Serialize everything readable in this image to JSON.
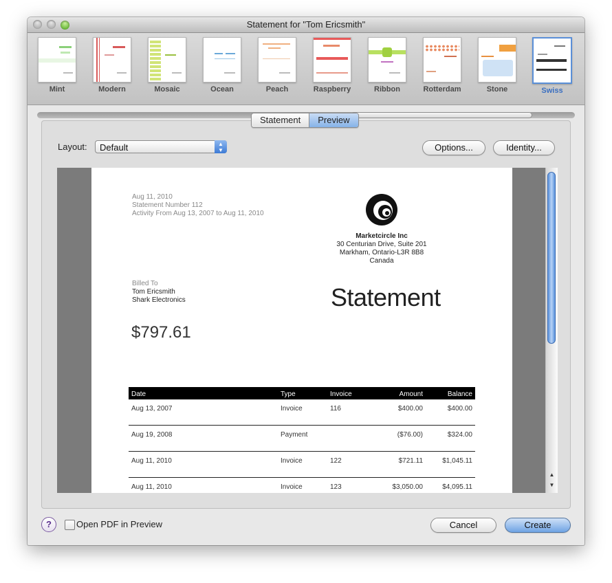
{
  "window": {
    "title": "Statement for \"Tom Ericsmith\""
  },
  "themes": [
    {
      "name": "Mint",
      "selected": false
    },
    {
      "name": "Modern",
      "selected": false
    },
    {
      "name": "Mosaic",
      "selected": false
    },
    {
      "name": "Ocean",
      "selected": false
    },
    {
      "name": "Peach",
      "selected": false
    },
    {
      "name": "Raspberry",
      "selected": false
    },
    {
      "name": "Ribbon",
      "selected": false
    },
    {
      "name": "Rotterdam",
      "selected": false
    },
    {
      "name": "Stone",
      "selected": false
    },
    {
      "name": "Swiss",
      "selected": true
    }
  ],
  "tabs": {
    "statement": "Statement",
    "preview": "Preview",
    "active": "Preview"
  },
  "layout": {
    "label": "Layout:",
    "value": "Default"
  },
  "buttons": {
    "options": "Options...",
    "identity": "Identity...",
    "cancel": "Cancel",
    "create": "Create"
  },
  "open_pdf": {
    "label": "Open PDF in Preview",
    "checked": false
  },
  "help_label": "?",
  "document": {
    "date": "Aug 11, 2010",
    "statement_number": "Statement Number 112",
    "activity": "Activity From Aug 13, 2007 to Aug 11, 2010",
    "company": {
      "name": "Marketcircle Inc",
      "address1": "30 Centurian Drive, Suite 201",
      "address2": "Markham, Ontario-L3R 8B8",
      "country": "Canada"
    },
    "billed_to_label": "Billed To",
    "billed_name": "Tom Ericsmith",
    "billed_company": "Shark Electronics",
    "title": "Statement",
    "total": "$797.61",
    "table": {
      "headers": {
        "date": "Date",
        "type": "Type",
        "invoice": "Invoice",
        "amount": "Amount",
        "balance": "Balance"
      },
      "rows": [
        {
          "date": "Aug 13, 2007",
          "type": "Invoice",
          "invoice": "116",
          "amount": "$400.00",
          "balance": "$400.00"
        },
        {
          "date": "Aug 19, 2008",
          "type": "Payment",
          "invoice": "",
          "amount": "($76.00)",
          "balance": "$324.00"
        },
        {
          "date": "Aug 11, 2010",
          "type": "Invoice",
          "invoice": "122",
          "amount": "$721.11",
          "balance": "$1,045.11"
        },
        {
          "date": "Aug 11, 2010",
          "type": "Invoice",
          "invoice": "123",
          "amount": "$3,050.00",
          "balance": "$4,095.11"
        }
      ]
    }
  },
  "colors": {
    "accent": "#6fa3e4",
    "selection": "#3a6fc0"
  }
}
